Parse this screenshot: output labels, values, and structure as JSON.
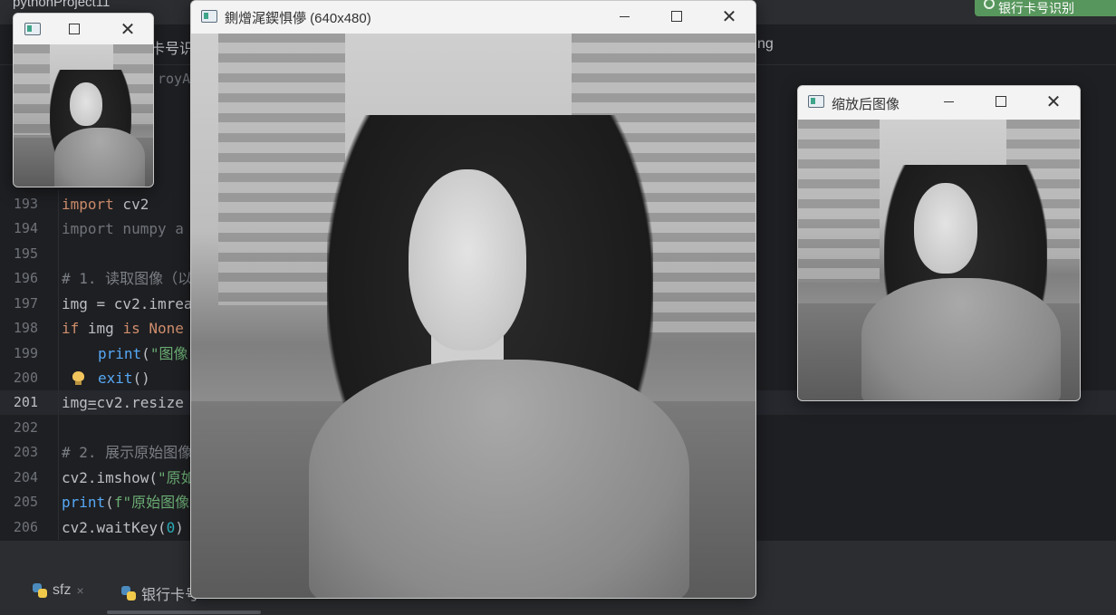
{
  "ide": {
    "project": "pythonProject11",
    "run_button": "银行卡号识别",
    "tabs": [
      "卡号识",
      "ng"
    ],
    "breadcrumb": "royA"
  },
  "code": {
    "gutter": [
      "193",
      "194",
      "195",
      "196",
      "197",
      "198",
      "199",
      "200",
      "201",
      "202",
      "203",
      "204",
      "205",
      "206"
    ],
    "line193": {
      "kw": "import",
      "rest": " cv2"
    },
    "line194": {
      "text": "import numpy a"
    },
    "line196": {
      "text": "# 1. 读取图像（以"
    },
    "line197": {
      "text": "img = cv2.imrea"
    },
    "line198": {
      "kw1": "if",
      "mid": " img ",
      "kw2": "is",
      "sp": " ",
      "kw3": "None"
    },
    "line199": {
      "fn": "print",
      "p": "(",
      "str": "\"图像"
    },
    "line200": {
      "fn": "exit",
      "rest": "()"
    },
    "line201": {
      "a": "img",
      "b": "=",
      "c": "cv2.resize"
    },
    "line203": {
      "text": "# 2. 展示原始图像"
    },
    "line204": {
      "a": "cv2.imshow(",
      "str": "\"原如"
    },
    "line205": {
      "fn": "print",
      "p": "(",
      "str": "f\"原始图像"
    },
    "line206": {
      "a": "cv2.waitKey(",
      "num": "0",
      "b": ")"
    }
  },
  "bottom_tabs": [
    {
      "label": "sfz",
      "close": "×"
    },
    {
      "label": "银行卡号"
    }
  ],
  "windows": {
    "main": {
      "title": "鍘熷浘鍥惧儚 (640x480)",
      "close": "✕"
    },
    "right": {
      "title": "缩放后图像",
      "close": "✕"
    },
    "small": {
      "close": "✕"
    }
  },
  "colors": {
    "run_button": "#57965c",
    "keyword": "#cf8e6d",
    "string": "#6aab73",
    "function": "#56a8f5"
  }
}
